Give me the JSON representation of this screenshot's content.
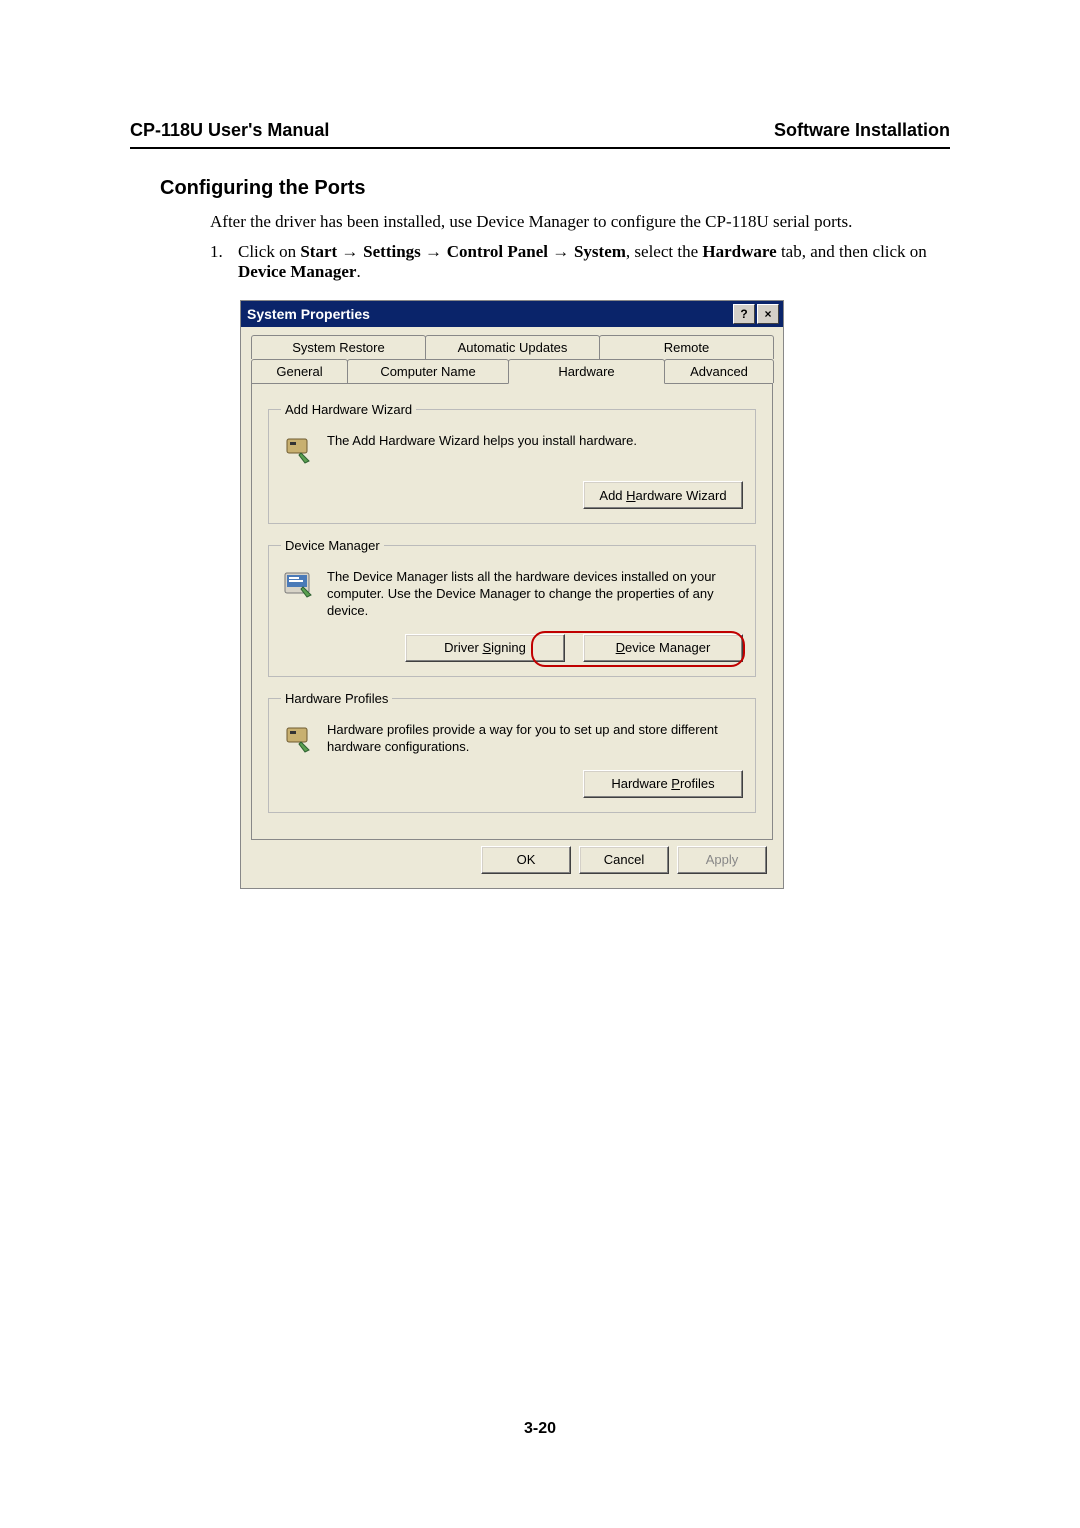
{
  "header": {
    "left": "CP-118U User's Manual",
    "right": "Software Installation"
  },
  "section_title": "Configuring the Ports",
  "intro": "After the driver has been installed, use Device Manager to configure the CP-118U serial ports.",
  "step": {
    "num": "1.",
    "pre": "Click on ",
    "b1": "Start",
    "b2": "Settings",
    "b3": "Control Panel",
    "b4": "System",
    "mid": ", select the ",
    "b5": "Hardware",
    "post1": " tab, and then click on ",
    "b6": "Device Manager",
    "post2": "."
  },
  "dialog": {
    "title": "System Properties",
    "help": "?",
    "close": "×",
    "tabs_top": [
      "System Restore",
      "Automatic Updates",
      "Remote"
    ],
    "tabs_bot": [
      "General",
      "Computer Name",
      "Hardware",
      "Advanced"
    ],
    "group1": {
      "legend": "Add Hardware Wizard",
      "text": "The Add Hardware Wizard helps you install hardware.",
      "btn": "Add Hardware Wizard"
    },
    "group2": {
      "legend": "Device Manager",
      "text": "The Device Manager lists all the hardware devices installed on your computer. Use the Device Manager to change the properties of any device.",
      "btn1": "Driver Signing",
      "btn2": "Device Manager"
    },
    "group3": {
      "legend": "Hardware Profiles",
      "text": "Hardware profiles provide a way for you to set up and store different hardware configurations.",
      "btn": "Hardware Profiles"
    },
    "ok": "OK",
    "cancel": "Cancel",
    "apply": "Apply"
  },
  "page_num": "3-20"
}
